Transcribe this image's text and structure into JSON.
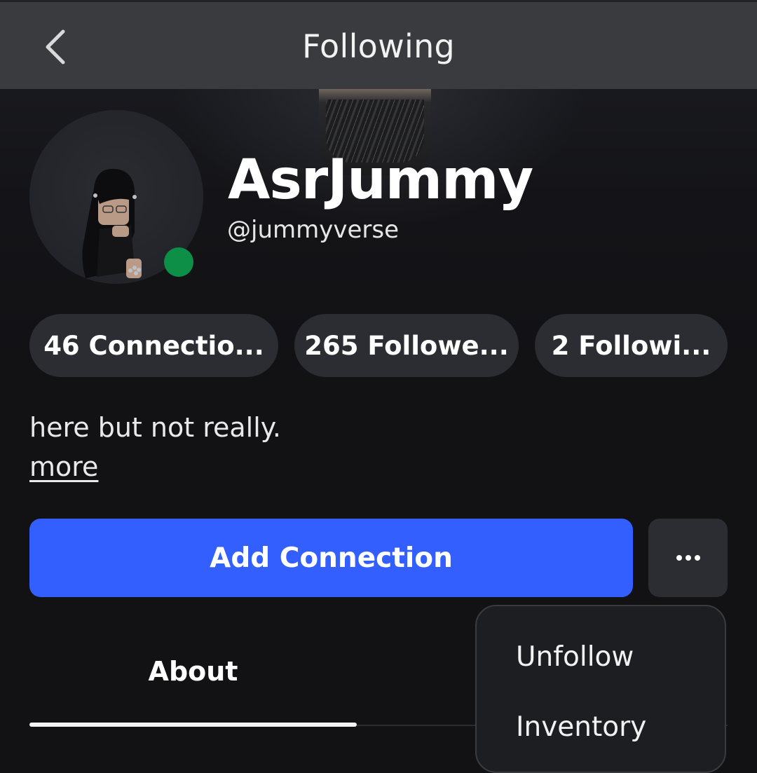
{
  "header": {
    "title": "Following"
  },
  "profile": {
    "display_name": "AsrJummy",
    "username": "@jummyverse",
    "online_color": "#0d8f48"
  },
  "stats": {
    "connections": "46 Connectio...",
    "followers": "265 Followe...",
    "following": "2 Followi..."
  },
  "bio": {
    "text": "here but not really.",
    "more_label": "more"
  },
  "actions": {
    "add_connection_label": "Add Connection",
    "accent_color": "#335fff"
  },
  "tabs": [
    {
      "label": "About",
      "active": true
    }
  ],
  "dropdown": {
    "items": [
      {
        "label": "Unfollow"
      },
      {
        "label": "Inventory"
      }
    ]
  }
}
